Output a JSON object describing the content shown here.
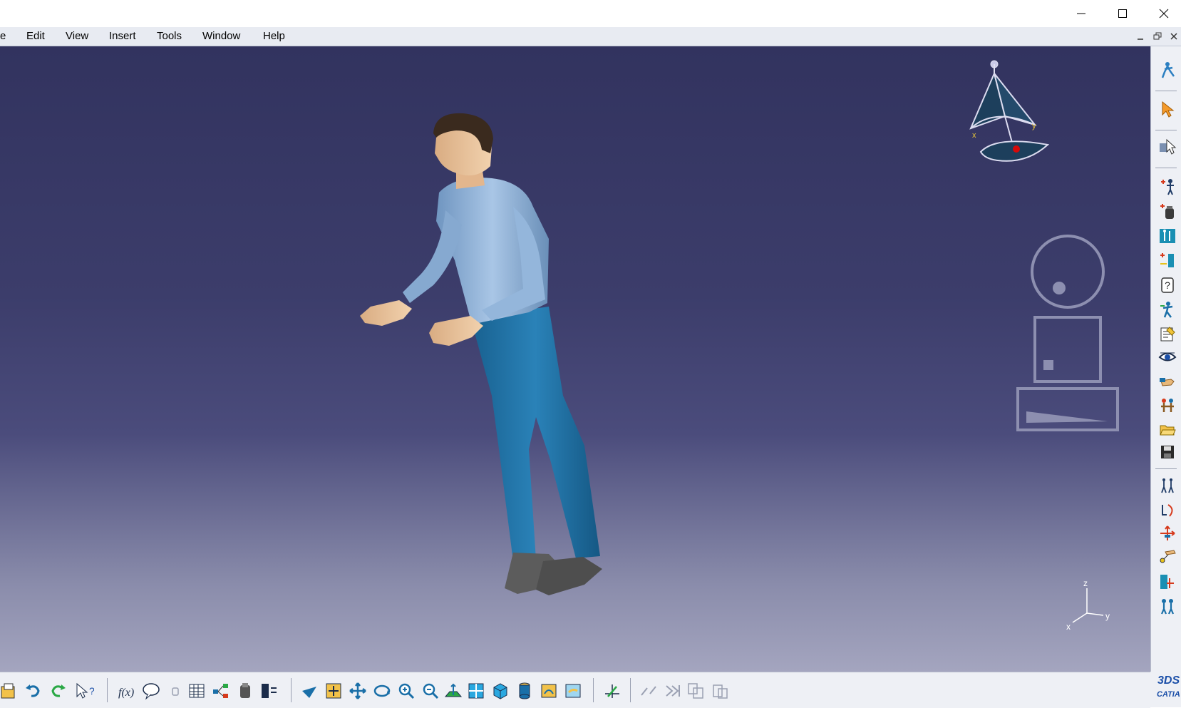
{
  "window": {
    "controls": {
      "minimize_icon": "window-minimize-icon",
      "maximize_icon": "window-maximize-icon",
      "close_icon": "window-close-icon"
    }
  },
  "menu": {
    "items": [
      {
        "label": "e"
      },
      {
        "label": "Edit"
      },
      {
        "label": "View"
      },
      {
        "label": "Insert"
      },
      {
        "label": "Tools"
      },
      {
        "label": "Window"
      },
      {
        "label": "Help"
      }
    ]
  },
  "viewport": {
    "background_top": "#32335f",
    "background_bottom": "#a4a5bf",
    "compass": {
      "x_label": "x",
      "y_label": "y"
    },
    "axis_triad": {
      "x": "x",
      "y": "y",
      "z": "z"
    },
    "manikin": {
      "shirt_color": "#8fb2d6",
      "pants_color": "#1f6fa3",
      "skin_color": "#e9c29a",
      "hair_color": "#3a2a1e",
      "shoes_color": "#5a5a5a"
    }
  },
  "right_toolbar": {
    "icons": [
      "manikin-compass-icon",
      "select-arrow-icon",
      "select-options-icon",
      "forward-kinematics-icon",
      "weight-icon",
      "anthropometry-icon",
      "posture-editor-icon",
      "help-icon",
      "reach-envelope-icon",
      "edit-properties-icon",
      "vision-eye-icon",
      "hand-grasp-icon",
      "swap-icon",
      "open-file-icon",
      "save-icon",
      "walk-icon",
      "arc-move-icon",
      "inverse-kinematics-icon",
      "manikin-attach-icon",
      "posture-optimization-icon",
      "multi-manikin-icon"
    ]
  },
  "bottom_toolbar": {
    "icons": [
      "new-file-icon",
      "undo-icon",
      "redo-icon",
      "whats-this-icon",
      "formula-icon",
      "comment-icon",
      "lock-icon",
      "table-icon",
      "graph-tree-icon",
      "catalog-icon",
      "knowledge-icon",
      "fly-mode-icon",
      "fit-all-icon",
      "pan-icon",
      "rotate-icon",
      "zoom-in-icon",
      "zoom-out-icon",
      "normal-view-icon",
      "multi-view-icon",
      "iso-view-icon",
      "shading-icon",
      "hide-show-icon",
      "swap-space-icon",
      "sketcher-icon",
      "break-icon",
      "skip-icon",
      "copy-props-icon",
      "paste-props-icon"
    ],
    "logo_text_top": "3DS",
    "logo_text_bottom": "CATIA"
  }
}
